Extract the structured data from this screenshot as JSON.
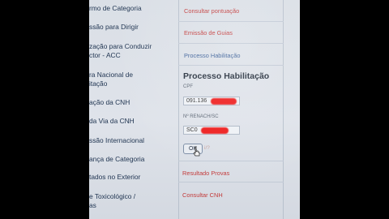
{
  "left_menu": [
    "rmo de Categoria",
    "ssão para Dirigir",
    "zação para Conduzir\nctor - ACC",
    "ra Nacional de\nitação",
    "ação da CNH",
    "da Via da CNH",
    "ssão Internacional",
    "ança de Categoria",
    "tados no Exterior",
    "e Toxicológico /\nas"
  ],
  "right_links": {
    "consultar_pontuacao": "Consultar pontuação",
    "emissao_guias": "Emissão de Guias",
    "processo_habilitacao": "Processo Habilitação"
  },
  "process": {
    "title": "Processo Habilitação",
    "cpf_label": "CPF",
    "cpf_value": "091.136",
    "renach_label": "Nº RENACH/SC",
    "renach_value": "SC0",
    "ok_label": "OK",
    "ok_extra": "i/?"
  },
  "bottom_links": {
    "resultado_provas": "Resultado Provas",
    "consultar_cnh": "Consultar CNH"
  },
  "colors": {
    "link_red": "#c23a3a",
    "link_blue": "#3a5f98",
    "redaction": "#ee1a1a"
  }
}
